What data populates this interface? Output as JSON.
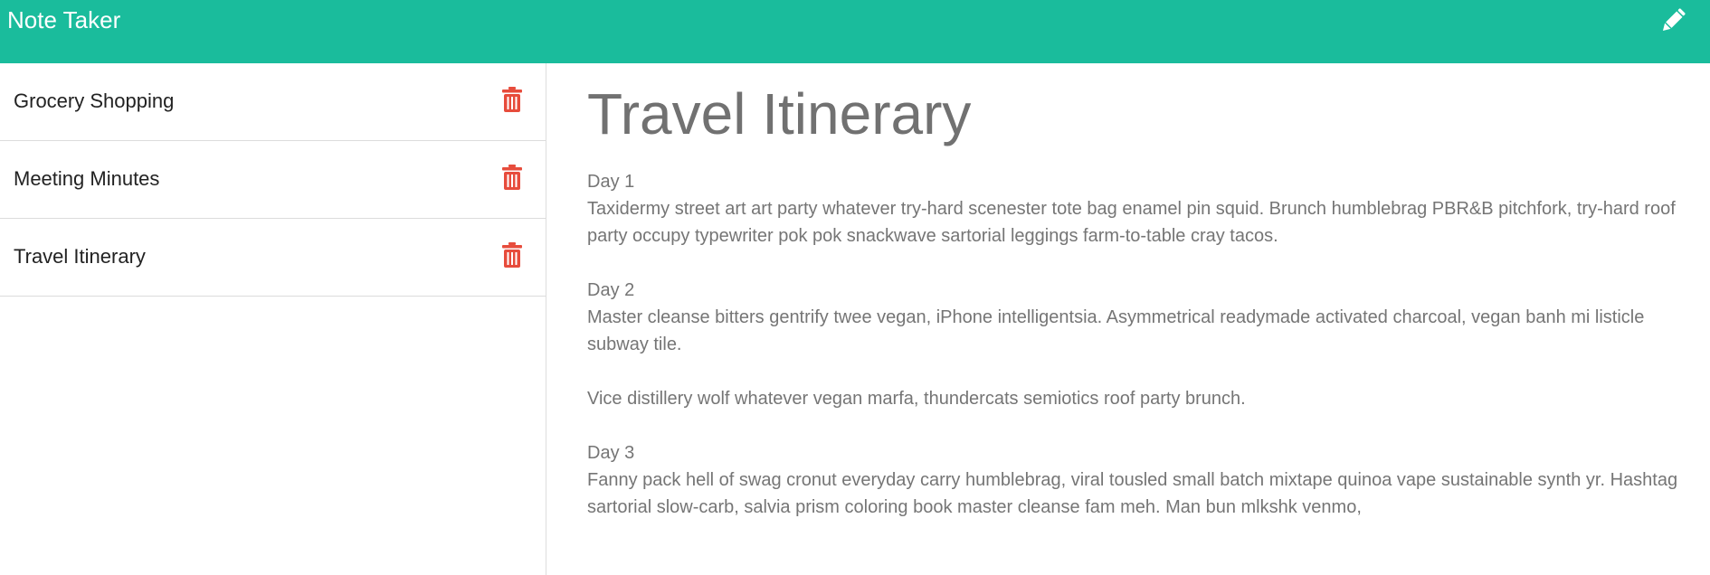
{
  "app": {
    "title": "Note Taker",
    "accent_color": "#1abc9c",
    "new_note_icon": "pencil-icon",
    "delete_icon": "trash-icon",
    "delete_color": "#e74c3c"
  },
  "notes": [
    {
      "title": "Grocery Shopping"
    },
    {
      "title": "Meeting Minutes"
    },
    {
      "title": "Travel Itinerary"
    }
  ],
  "active_note": {
    "title": "Travel Itinerary",
    "paragraphs": [
      {
        "heading": "Day 1",
        "text": "Taxidermy street art art party whatever try-hard scenester tote bag enamel pin squid. Brunch humblebrag PBR&B pitchfork, try-hard roof party occupy typewriter pok pok snackwave sartorial leggings farm-to-table cray tacos."
      },
      {
        "heading": "Day 2",
        "text": "Master cleanse bitters gentrify twee vegan, iPhone intelligentsia. Asymmetrical readymade activated charcoal, vegan banh mi listicle subway tile."
      },
      {
        "heading": "",
        "text": "Vice distillery wolf whatever vegan marfa, thundercats semiotics roof party brunch."
      },
      {
        "heading": "Day 3",
        "text": "Fanny pack hell of swag cronut everyday carry humblebrag, viral tousled small batch mixtape quinoa vape sustainable synth yr. Hashtag sartorial slow-carb, salvia prism coloring book master cleanse fam meh. Man bun mlkshk venmo,"
      }
    ]
  }
}
